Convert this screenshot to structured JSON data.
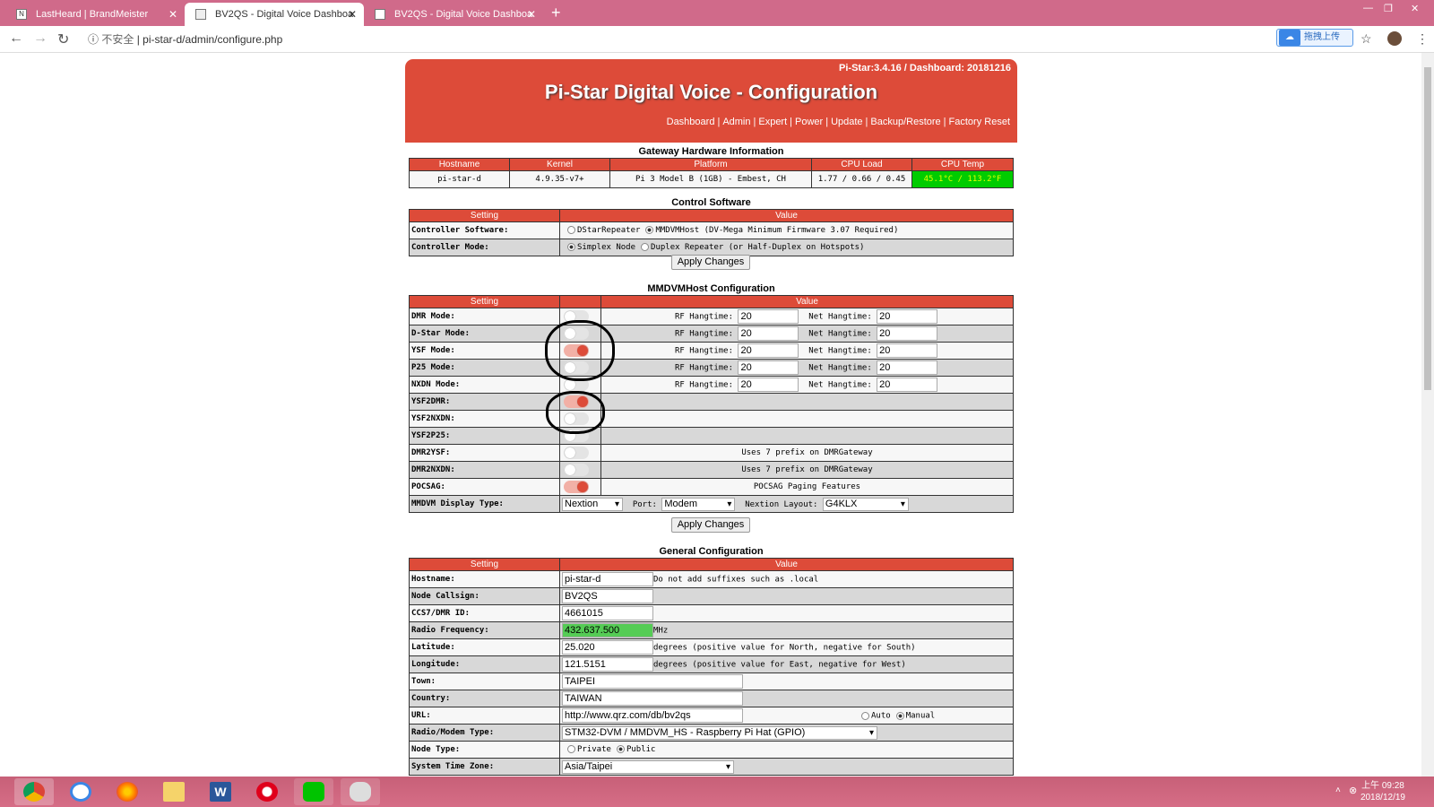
{
  "tabs": [
    {
      "label": "LastHeard | BrandMeister"
    },
    {
      "label": "BV2QS - Digital Voice Dashboa"
    },
    {
      "label": "BV2QS - Digital Voice Dashboa"
    }
  ],
  "address": {
    "insecure": "不安全",
    "url": "pi-star-d/admin/configure.php"
  },
  "upload_button": "拖拽上传",
  "header": {
    "version": "Pi-Star:3.4.16 / Dashboard: 20181216",
    "title": "Pi-Star Digital Voice - Configuration",
    "menu": [
      "Dashboard",
      "Admin",
      "Expert",
      "Power",
      "Update",
      "Backup/Restore",
      "Factory Reset"
    ]
  },
  "hw": {
    "title": "Gateway Hardware Information",
    "headers": [
      "Hostname",
      "Kernel",
      "Platform",
      "CPU Load",
      "CPU Temp"
    ],
    "values": [
      "pi-star-d",
      "4.9.35-v7+",
      "Pi 3 Model B (1GB) - Embest, CH",
      "1.77 / 0.66 / 0.45",
      "45.1°C / 113.2°F"
    ]
  },
  "control": {
    "title": "Control Software",
    "col_setting": "Setting",
    "col_value": "Value",
    "rows": [
      {
        "label": "Controller Software:",
        "opt1": "DStarRepeater",
        "opt2": "MMDVMHost (DV-Mega Minimum Firmware 3.07 Required)"
      },
      {
        "label": "Controller Mode:",
        "opt1": "Simplex Node",
        "opt2": "Duplex Repeater (or Half-Duplex on Hotspots)"
      }
    ],
    "apply": "Apply Changes"
  },
  "mmdvm": {
    "title": "MMDVMHost Configuration",
    "col_setting": "Setting",
    "col_value": "Value",
    "rf_label": "RF Hangtime:",
    "net_label": "Net Hangtime:",
    "modes": [
      {
        "label": "DMR Mode:",
        "rf": "20",
        "net": "20"
      },
      {
        "label": "D-Star Mode:",
        "rf": "20",
        "net": "20"
      },
      {
        "label": "YSF Mode:",
        "rf": "20",
        "net": "20"
      },
      {
        "label": "P25 Mode:",
        "rf": "20",
        "net": "20"
      },
      {
        "label": "NXDN Mode:",
        "rf": "20",
        "net": "20"
      }
    ],
    "cross": [
      {
        "label": "YSF2DMR:",
        "note": ""
      },
      {
        "label": "YSF2NXDN:",
        "note": ""
      },
      {
        "label": "YSF2P25:",
        "note": ""
      },
      {
        "label": "DMR2YSF:",
        "note": "Uses 7 prefix on DMRGateway"
      },
      {
        "label": "DMR2NXDN:",
        "note": "Uses 7 prefix on DMRGateway"
      },
      {
        "label": "POCSAG:",
        "note": "POCSAG Paging Features"
      }
    ],
    "display": {
      "label": "MMDVM Display Type:",
      "type": "Nextion",
      "port_label": "Port:",
      "port": "Modem",
      "layout_label": "Nextion Layout:",
      "layout": "G4KLX"
    },
    "apply": "Apply Changes"
  },
  "general": {
    "title": "General Configuration",
    "col_setting": "Setting",
    "col_value": "Value",
    "hostname": {
      "label": "Hostname:",
      "value": "pi-star-d",
      "note": "Do not add suffixes such as .local"
    },
    "callsign": {
      "label": "Node Callsign:",
      "value": "BV2QS"
    },
    "dmrid": {
      "label": "CCS7/DMR ID:",
      "value": "4661015"
    },
    "freq": {
      "label": "Radio Frequency:",
      "value": "432.637.500",
      "unit": "MHz"
    },
    "lat": {
      "label": "Latitude:",
      "value": "25.020",
      "note": "degrees (positive value for North, negative for South)"
    },
    "lon": {
      "label": "Longitude:",
      "value": "121.5151",
      "note": "degrees (positive value for East, negative for West)"
    },
    "town": {
      "label": "Town:",
      "value": "TAIPEI"
    },
    "country": {
      "label": "Country:",
      "value": "TAIWAN"
    },
    "url": {
      "label": "URL:",
      "value": "http://www.qrz.com/db/bv2qs",
      "auto": "Auto",
      "manual": "Manual"
    },
    "modem": {
      "label": "Radio/Modem Type:",
      "value": "STM32-DVM / MMDVM_HS - Raspberry Pi Hat (GPIO)"
    },
    "nodetype": {
      "label": "Node Type:",
      "private": "Private",
      "public": "Public"
    },
    "tz": {
      "label": "System Time Zone:",
      "value": "Asia/Taipei"
    }
  },
  "clock": {
    "time": "上午 09:28",
    "date": "2018/12/19"
  }
}
